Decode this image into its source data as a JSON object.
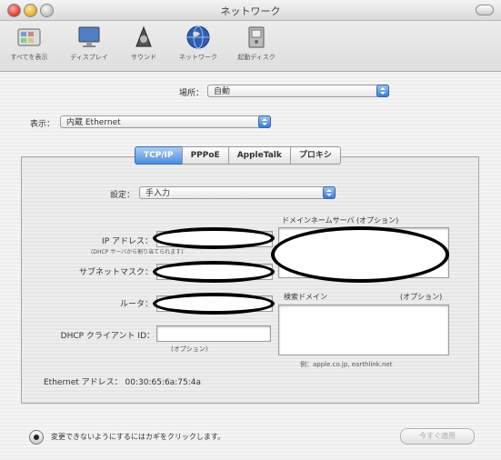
{
  "window": {
    "title": "ネットワーク"
  },
  "toolbar": {
    "items": [
      {
        "label": "すべてを表示",
        "icon": "show-all-icon"
      },
      {
        "label": "ディスプレイ",
        "icon": "display-icon"
      },
      {
        "label": "サウンド",
        "icon": "sound-icon"
      },
      {
        "label": "ネットワーク",
        "icon": "network-globe-icon"
      },
      {
        "label": "起動ディスク",
        "icon": "startup-disk-icon"
      }
    ]
  },
  "location": {
    "label": "場所：",
    "value": "自動"
  },
  "show": {
    "label": "表示：",
    "value": "内蔵 Ethernet"
  },
  "tabs": [
    "TCP/IP",
    "PPPoE",
    "AppleTalk",
    "プロキシ"
  ],
  "tcpip": {
    "config_label": "設定：",
    "config_value": "手入力",
    "ip_label": "IP アドレス：",
    "ip_note": "(DHCP サーバから割り当てられます)",
    "subnet_label": "サブネットマスク：",
    "router_label": "ルータ：",
    "dhcp_client_label": "DHCP クライアント ID：",
    "dhcp_optional": "(オプション)",
    "ethernet_label": "Ethernet アドレス：",
    "ethernet_value": "00:30:65:6a:75:4a",
    "dns_label": "ドメインネームサーバ (オプション)",
    "search_domain_label": "検索ドメイン",
    "search_domain_optional": "(オプション)",
    "example_text": "例：apple.co.jp, earthlink.net"
  },
  "footer": {
    "lock_text": "変更できないようにするにはカギをクリックします。",
    "apply_button": "今すぐ適用"
  }
}
